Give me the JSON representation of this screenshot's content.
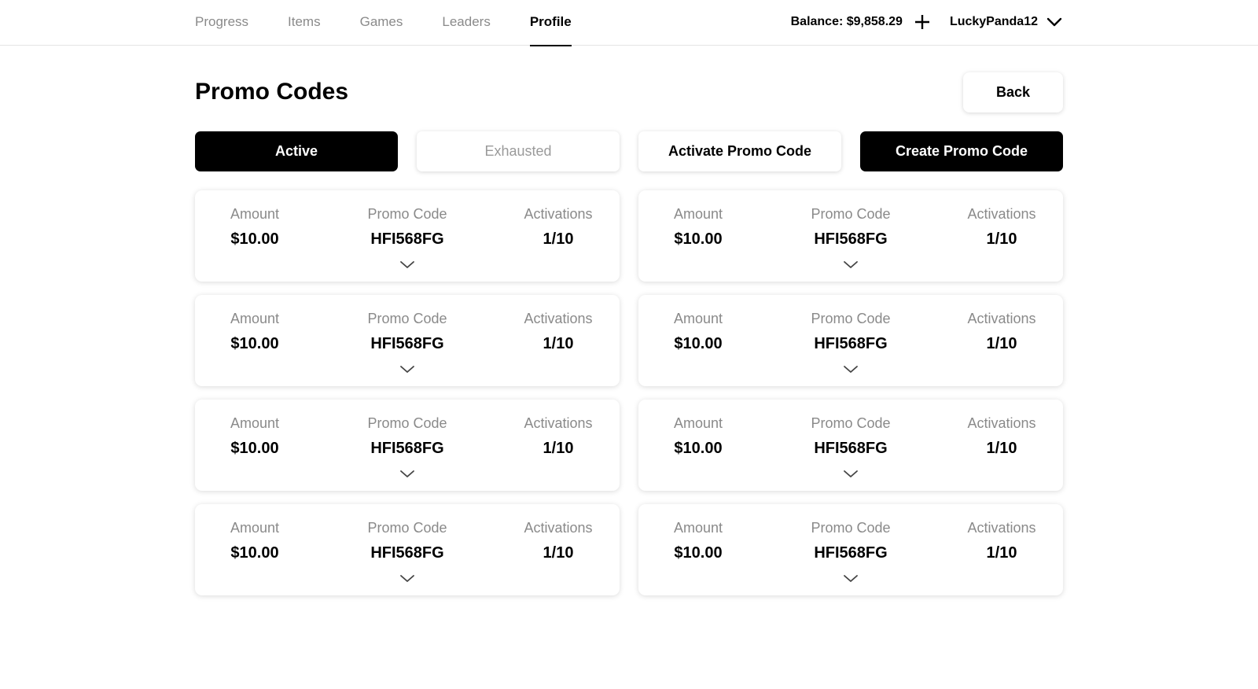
{
  "nav": {
    "items": [
      {
        "label": "Progress",
        "active": false
      },
      {
        "label": "Items",
        "active": false
      },
      {
        "label": "Games",
        "active": false
      },
      {
        "label": "Leaders",
        "active": false
      },
      {
        "label": "Profile",
        "active": true
      }
    ]
  },
  "account": {
    "balance": "Balance: $9,858.29",
    "username": "LuckyPanda12"
  },
  "header": {
    "title": "Promo Codes",
    "back_label": "Back"
  },
  "actions": {
    "tab_active": "Active",
    "tab_exhausted": "Exhausted",
    "activate_label": "Activate Promo Code",
    "create_label": "Create Promo Code"
  },
  "columns": {
    "amount": "Amount",
    "code": "Promo Code",
    "activations": "Activations"
  },
  "promo_codes": [
    {
      "amount": "$10.00",
      "code": "HFI568FG",
      "activations": "1/10"
    },
    {
      "amount": "$10.00",
      "code": "HFI568FG",
      "activations": "1/10"
    },
    {
      "amount": "$10.00",
      "code": "HFI568FG",
      "activations": "1/10"
    },
    {
      "amount": "$10.00",
      "code": "HFI568FG",
      "activations": "1/10"
    },
    {
      "amount": "$10.00",
      "code": "HFI568FG",
      "activations": "1/10"
    },
    {
      "amount": "$10.00",
      "code": "HFI568FG",
      "activations": "1/10"
    },
    {
      "amount": "$10.00",
      "code": "HFI568FG",
      "activations": "1/10"
    },
    {
      "amount": "$10.00",
      "code": "HFI568FG",
      "activations": "1/10"
    }
  ],
  "icons": {
    "add": "plus-icon",
    "account_menu": "chevron-down-icon",
    "expand": "chevron-down-icon"
  },
  "colors": {
    "primary": "#000000",
    "muted_text": "#8a8a8a",
    "background": "#ffffff"
  }
}
